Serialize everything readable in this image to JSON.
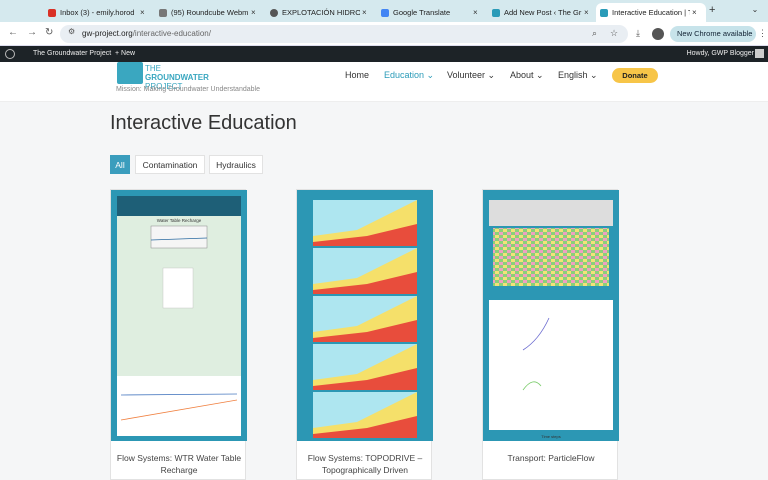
{
  "browser": {
    "tabs": [
      {
        "title": "Inbox (3) - emily.horod",
        "active": false
      },
      {
        "title": "(95) Roundcube Webm",
        "active": false
      },
      {
        "title": "EXPLOTACIÓN HIDROG",
        "active": false
      },
      {
        "title": "Google Translate",
        "active": false
      },
      {
        "title": "Add New Post ‹ The Gr",
        "active": false
      },
      {
        "title": "Interactive Education | T",
        "active": true
      }
    ],
    "url_domain": "gw-project.org",
    "url_path": "/interactive-education/",
    "new_chrome_label": "New Chrome available"
  },
  "wp_admin": {
    "site_name": "The Groundwater Project",
    "new_label": "+ New",
    "greeting": "Howdy, GWP Blogger"
  },
  "site": {
    "logo_line1": "THE",
    "logo_line2": "GROUNDWATER",
    "logo_line3": "PROJECT",
    "mission": "Mission: Making Groundwater Understandable",
    "nav": [
      {
        "label": "Home",
        "active": false
      },
      {
        "label": "Education ⌄",
        "active": true
      },
      {
        "label": "Volunteer ⌄",
        "active": false
      },
      {
        "label": "About ⌄",
        "active": false
      },
      {
        "label": "English ⌄",
        "active": false
      }
    ],
    "donate_label": "Donate"
  },
  "page": {
    "title": "Interactive Education",
    "filters": [
      {
        "label": "All",
        "active": true
      },
      {
        "label": "Contamination",
        "active": false
      },
      {
        "label": "Hydraulics",
        "active": false
      }
    ],
    "cards": [
      {
        "title": "Flow Systems: WTR Water Table Recharge",
        "thumb": "wtr-app-screenshot"
      },
      {
        "title": "Flow Systems: TOPODRIVE – Topographically Driven",
        "thumb": "topodrive-panels"
      },
      {
        "title": "Transport: ParticleFlow",
        "thumb": "particleflow-app"
      }
    ],
    "wtr_thumb_heading": "Water Table Recharge",
    "pf_axis_label": "Time steps"
  },
  "colors": {
    "accent": "#2a9bb8",
    "donate": "#f7c548",
    "thumb_border": "#2c97b4"
  }
}
